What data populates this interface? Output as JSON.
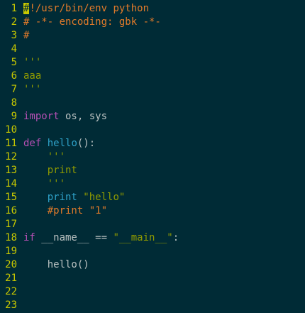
{
  "colors": {
    "background": "#002b36",
    "line_number": "#c8c800",
    "comment": "#e07a2a",
    "string": "#8f9a00",
    "keyword": "#b44fb3",
    "function": "#2ea2c9",
    "plain": "#b9c1c1"
  },
  "editor": {
    "lines": [
      {
        "number": "1",
        "tokens": [
          {
            "text": "#",
            "type": "cursor"
          },
          {
            "text": "!/usr/bin/env python",
            "type": "comment"
          }
        ]
      },
      {
        "number": "2",
        "tokens": [
          {
            "text": "# -*- encoding: gbk -*-",
            "type": "comment"
          }
        ]
      },
      {
        "number": "3",
        "tokens": [
          {
            "text": "#",
            "type": "comment"
          }
        ]
      },
      {
        "number": "4",
        "tokens": []
      },
      {
        "number": "5",
        "tokens": [
          {
            "text": "'''",
            "type": "string"
          }
        ]
      },
      {
        "number": "6",
        "tokens": [
          {
            "text": "aaa",
            "type": "string"
          }
        ]
      },
      {
        "number": "7",
        "tokens": [
          {
            "text": "'''",
            "type": "string"
          }
        ]
      },
      {
        "number": "8",
        "tokens": []
      },
      {
        "number": "9",
        "tokens": [
          {
            "text": "import",
            "type": "keyword"
          },
          {
            "text": " os, sys",
            "type": "plain"
          }
        ]
      },
      {
        "number": "10",
        "tokens": []
      },
      {
        "number": "11",
        "tokens": [
          {
            "text": "def",
            "type": "keyword"
          },
          {
            "text": " ",
            "type": "plain"
          },
          {
            "text": "hello",
            "type": "func"
          },
          {
            "text": "():",
            "type": "plain"
          }
        ]
      },
      {
        "number": "12",
        "tokens": [
          {
            "text": "    '''",
            "type": "string"
          }
        ]
      },
      {
        "number": "13",
        "tokens": [
          {
            "text": "    print",
            "type": "string"
          }
        ]
      },
      {
        "number": "14",
        "tokens": [
          {
            "text": "    '''",
            "type": "string"
          }
        ]
      },
      {
        "number": "15",
        "tokens": [
          {
            "text": "    ",
            "type": "plain"
          },
          {
            "text": "print",
            "type": "func"
          },
          {
            "text": " \"hello\"",
            "type": "string"
          }
        ]
      },
      {
        "number": "16",
        "tokens": [
          {
            "text": "    #print \"1\"",
            "type": "comment"
          }
        ]
      },
      {
        "number": "17",
        "tokens": []
      },
      {
        "number": "18",
        "tokens": [
          {
            "text": "if",
            "type": "keyword"
          },
          {
            "text": " __name__ == ",
            "type": "plain"
          },
          {
            "text": "\"__main__\"",
            "type": "string"
          },
          {
            "text": ":",
            "type": "plain"
          }
        ]
      },
      {
        "number": "19",
        "tokens": []
      },
      {
        "number": "20",
        "tokens": [
          {
            "text": "    hello()",
            "type": "plain"
          }
        ]
      },
      {
        "number": "21",
        "tokens": []
      },
      {
        "number": "22",
        "tokens": []
      },
      {
        "number": "23",
        "tokens": []
      }
    ]
  }
}
